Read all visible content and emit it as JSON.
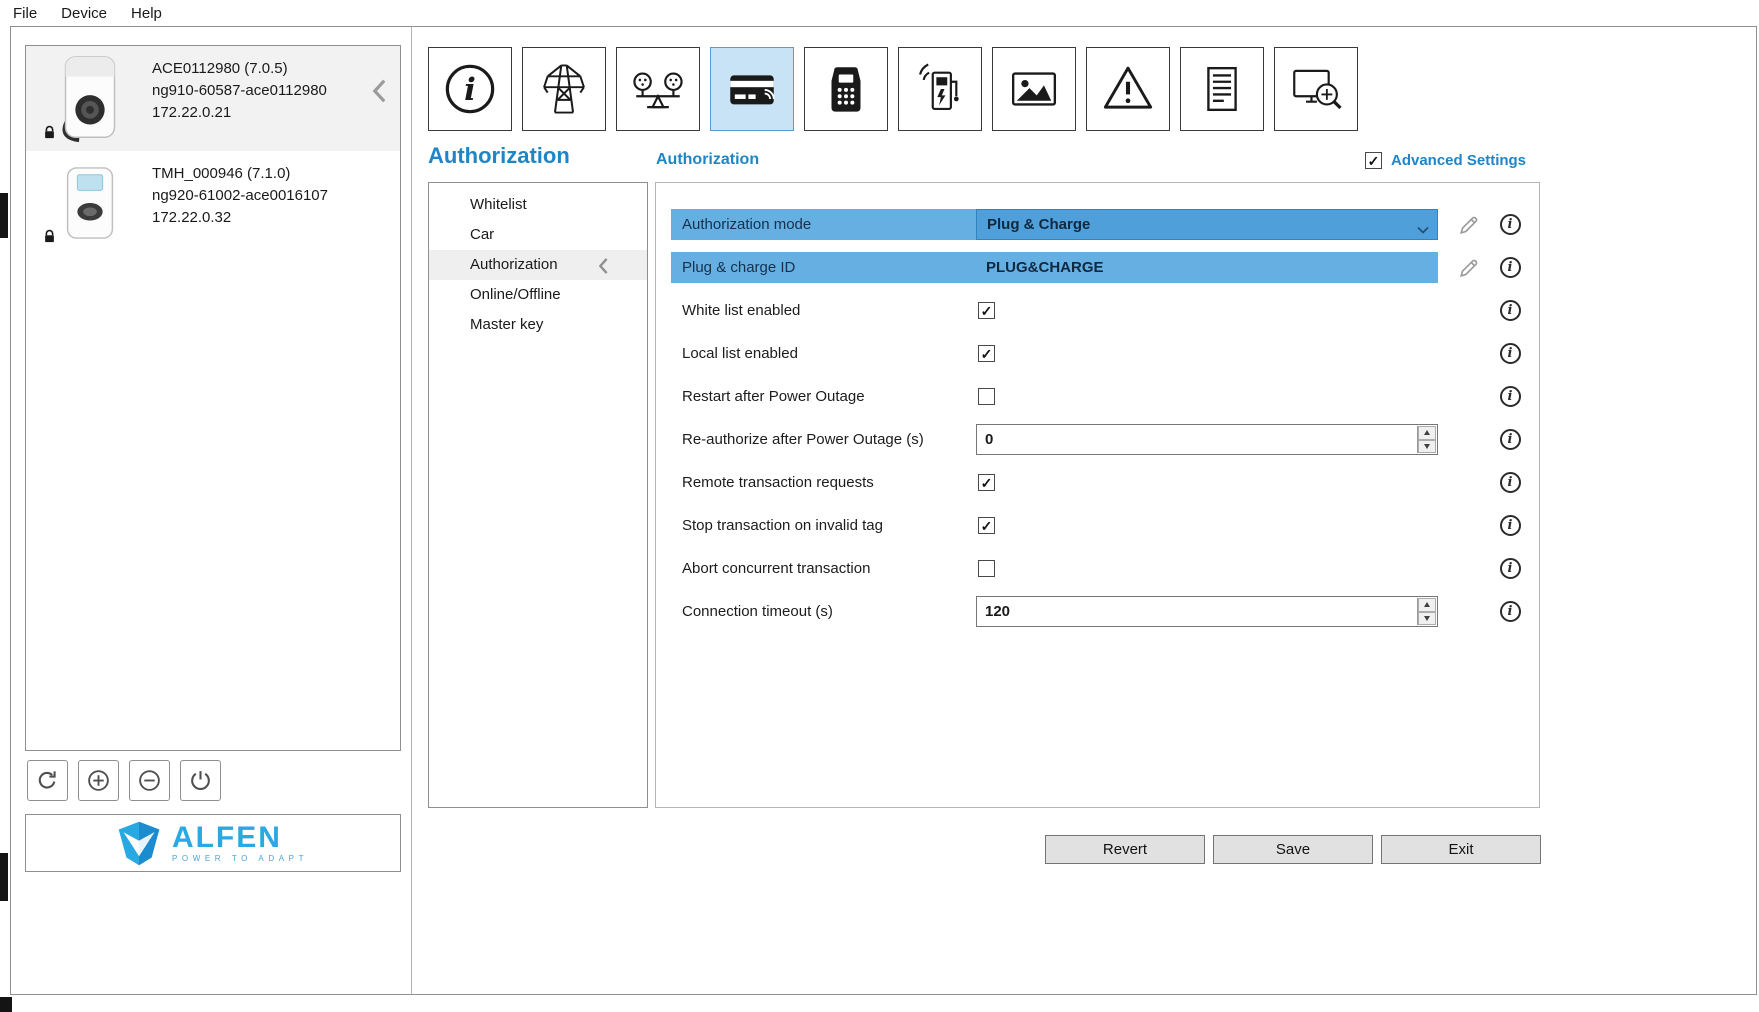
{
  "menu": {
    "items": [
      {
        "label": "File"
      },
      {
        "label": "Device"
      },
      {
        "label": "Help"
      }
    ]
  },
  "device_panel": {
    "devices": [
      {
        "name": "ACE0112980 (7.0.5)",
        "code": "ng910-60587-ace0112980",
        "ip": "172.22.0.21",
        "selected": true,
        "locked": true,
        "image": "wallbox"
      },
      {
        "name": "TMH_000946 (7.1.0)",
        "code": "ng920-61002-ace0016107",
        "ip": "172.22.0.32",
        "selected": false,
        "locked": true,
        "image": "compact"
      }
    ],
    "toolbar": [
      {
        "icon": "refresh-icon"
      },
      {
        "icon": "add-icon"
      },
      {
        "icon": "remove-icon"
      },
      {
        "icon": "power-icon"
      }
    ],
    "logo": {
      "brand": "ALFEN",
      "tagline": "POWER TO ADAPT",
      "color": "#2aa9e1"
    }
  },
  "icon_toolbar": [
    {
      "icon": "info-icon",
      "selected": false
    },
    {
      "icon": "power-grid-icon",
      "selected": false
    },
    {
      "icon": "load-balancing-icon",
      "selected": false
    },
    {
      "icon": "authorization-card-icon",
      "selected": true
    },
    {
      "icon": "payment-terminal-icon",
      "selected": false
    },
    {
      "icon": "charging-station-icon",
      "selected": false
    },
    {
      "icon": "display-image-icon",
      "selected": false
    },
    {
      "icon": "warning-icon",
      "selected": false
    },
    {
      "icon": "license-document-icon",
      "selected": false
    },
    {
      "icon": "diagnostics-icon",
      "selected": false
    }
  ],
  "section": {
    "title": "Authorization",
    "nav": [
      {
        "label": "Whitelist",
        "selected": false
      },
      {
        "label": "Car",
        "selected": false
      },
      {
        "label": "Authorization",
        "selected": true
      },
      {
        "label": "Online/Offline",
        "selected": false
      },
      {
        "label": "Master key",
        "selected": false
      }
    ],
    "panel_title": "Authorization",
    "advanced_settings": {
      "label": "Advanced Settings",
      "checked": true
    }
  },
  "fields": [
    {
      "label": "Authorization mode",
      "type": "dropdown",
      "value": "Plug & Charge",
      "highlighted": true,
      "editable": true
    },
    {
      "label": "Plug & charge ID",
      "type": "static",
      "value": "PLUG&CHARGE",
      "highlighted": true,
      "editable": true
    },
    {
      "label": "White list enabled",
      "type": "checkbox",
      "checked": true
    },
    {
      "label": "Local list enabled",
      "type": "checkbox",
      "checked": true
    },
    {
      "label": "Restart after Power Outage",
      "type": "checkbox",
      "checked": false
    },
    {
      "label": "Re-authorize after Power Outage (s)",
      "type": "number",
      "value": "0"
    },
    {
      "label": "Remote transaction requests",
      "type": "checkbox",
      "checked": true
    },
    {
      "label": "Stop transaction on invalid tag",
      "type": "checkbox",
      "checked": true
    },
    {
      "label": "Abort concurrent transaction",
      "type": "checkbox",
      "checked": false
    },
    {
      "label": "Connection timeout (s)",
      "type": "number",
      "value": "120"
    }
  ],
  "action_buttons": [
    {
      "label": "Revert"
    },
    {
      "label": "Save"
    },
    {
      "label": "Exit"
    }
  ],
  "colors": {
    "accent_blue": "#1e86c7",
    "row_highlight": "#66afe3",
    "control_highlight": "#4e9fda",
    "selected_tab_bg": "#c9e3f6"
  }
}
